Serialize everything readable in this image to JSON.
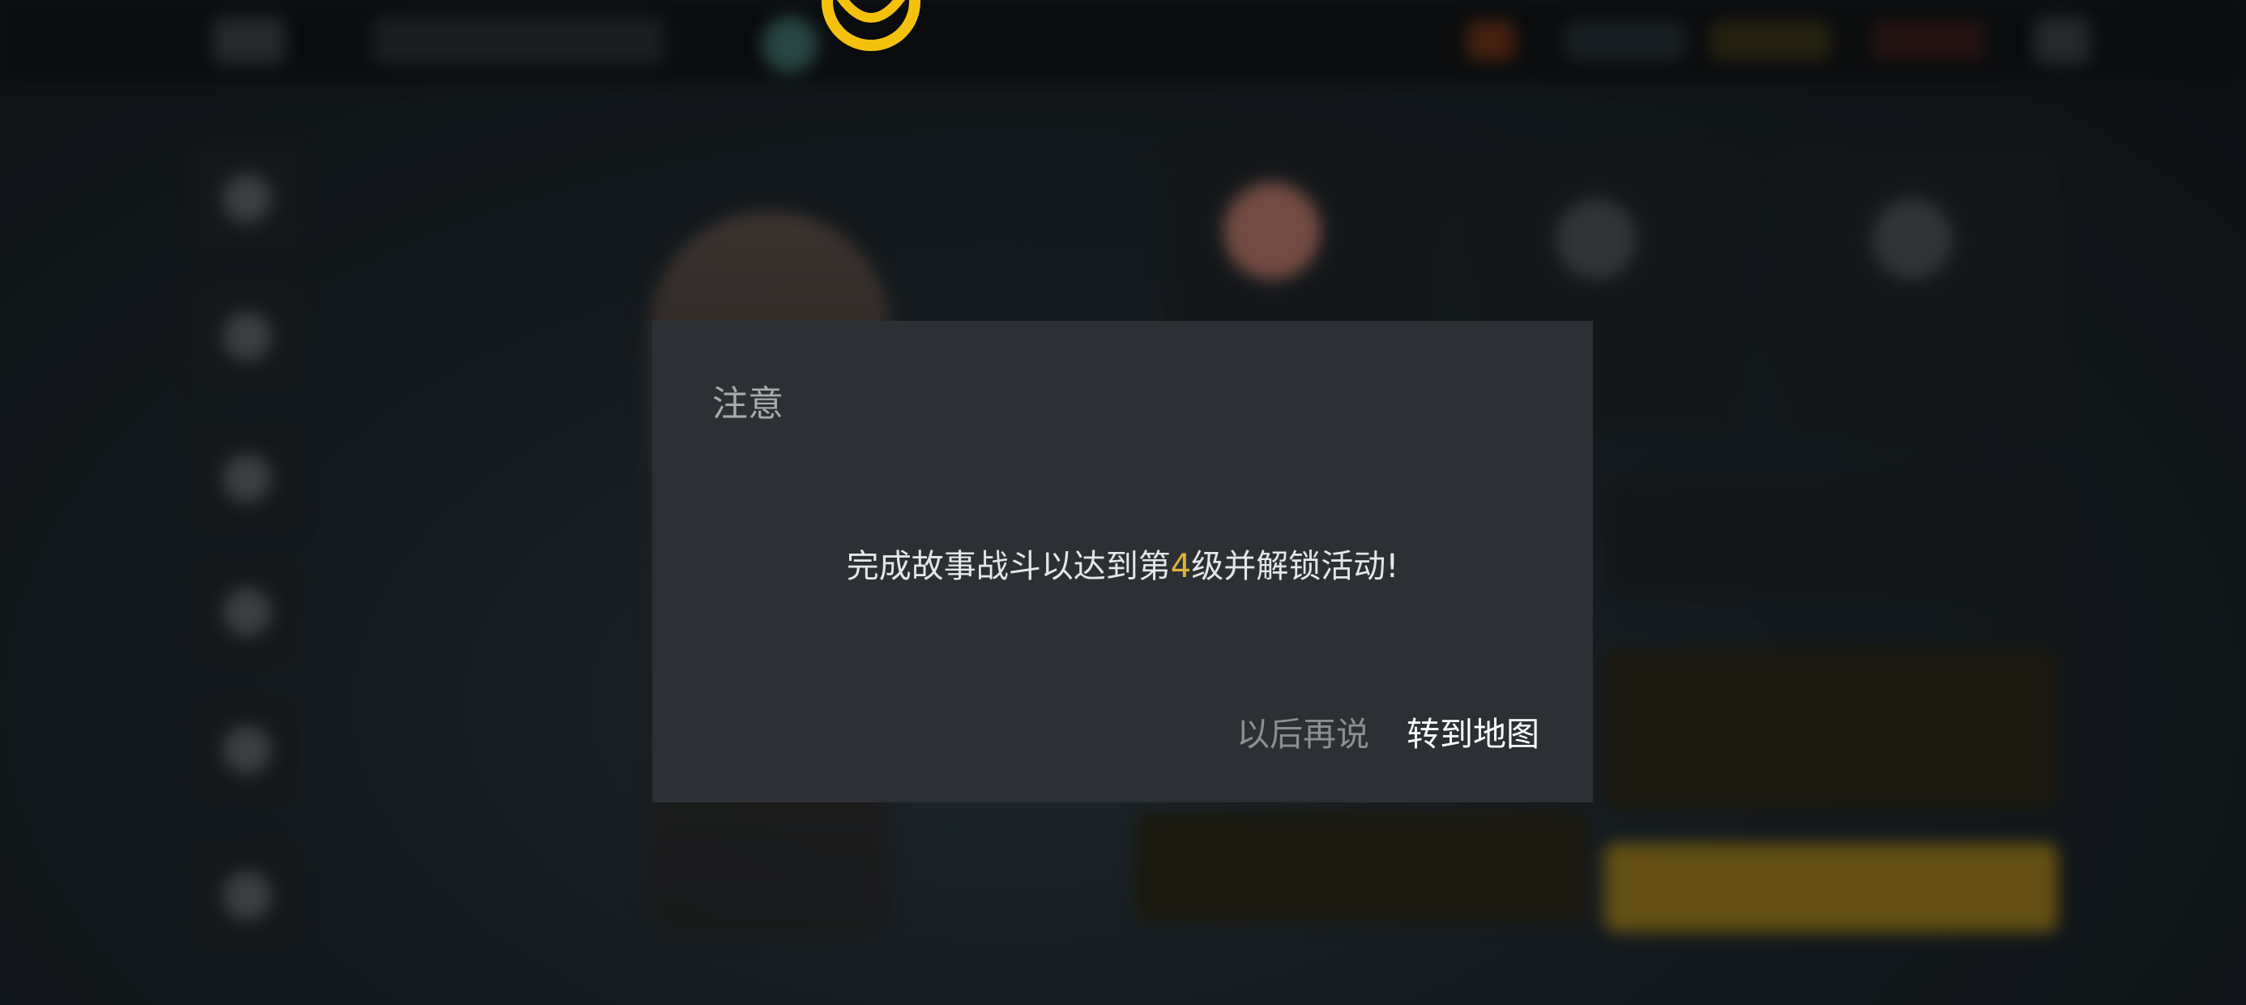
{
  "dialog": {
    "title": "注意",
    "message_prefix": "完成故事战斗以达到第",
    "message_level": "4",
    "message_suffix": "级并解锁活动!",
    "later_label": "以后再说",
    "go_to_map_label": "转到地图"
  },
  "colors": {
    "dialog_bg": "#2c3034",
    "highlight": "#e2b23a",
    "logo": "#f4c20d"
  }
}
